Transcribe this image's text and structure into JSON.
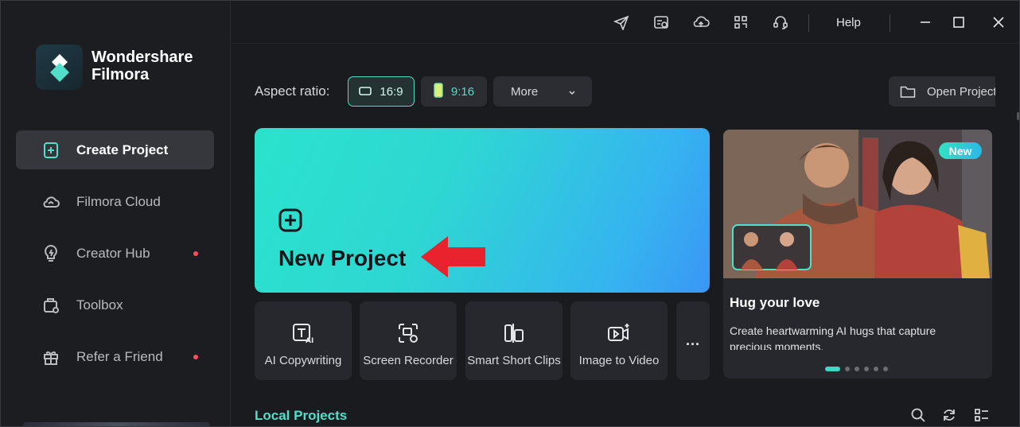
{
  "app": {
    "brand_line1": "Wondershare",
    "brand_line2": "Filmora",
    "accent_color": "#52dfc9"
  },
  "sidebar": {
    "items": [
      {
        "label": "Create Project",
        "icon": "new-project-icon",
        "active": true,
        "badge": false
      },
      {
        "label": "Filmora Cloud",
        "icon": "cloud-icon",
        "active": false,
        "badge": false
      },
      {
        "label": "Creator Hub",
        "icon": "bulb-icon",
        "active": false,
        "badge": true
      },
      {
        "label": "Toolbox",
        "icon": "toolbox-icon",
        "active": false,
        "badge": false
      },
      {
        "label": "Refer a Friend",
        "icon": "gift-icon",
        "active": false,
        "badge": true
      }
    ]
  },
  "topbar": {
    "icons": [
      "send-icon",
      "tasks-icon",
      "cloud-upload-icon",
      "apps-grid-icon",
      "headset-icon"
    ],
    "help_label": "Help",
    "window_controls": [
      "minimize-icon",
      "maximize-icon",
      "close-icon"
    ]
  },
  "aspect": {
    "label": "Aspect ratio:",
    "options": [
      {
        "label": "16:9",
        "selected": true
      },
      {
        "label": "9:16",
        "selected": false
      }
    ],
    "more_label": "More",
    "open_project_label": "Open Project"
  },
  "new_project": {
    "label": "New Project"
  },
  "tools": [
    {
      "label": "AI Copywriting",
      "icon": "ai-text-icon"
    },
    {
      "label": "Screen Recorder",
      "icon": "screen-record-icon"
    },
    {
      "label": "Smart Short Clips",
      "icon": "short-clips-icon"
    },
    {
      "label": "Image to Video",
      "icon": "image-to-video-icon"
    }
  ],
  "tools_more_label": "...",
  "promo": {
    "badge": "New",
    "title": "Hug your love",
    "description": "Create heartwarming AI hugs that capture precious moments.",
    "slide_count": 6,
    "current_slide": 1
  },
  "local_projects": {
    "title": "Local Projects",
    "icons": [
      "search-icon",
      "refresh-icon",
      "list-view-icon"
    ]
  }
}
